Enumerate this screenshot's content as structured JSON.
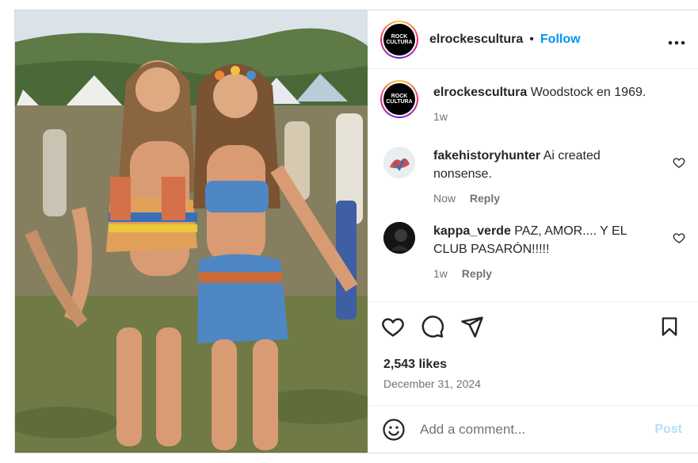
{
  "post": {
    "author": "elrockescultura",
    "separator": "•",
    "follow_label": "Follow",
    "more_icon": "more-horizontal-icon",
    "avatar_text_top": "ROCK",
    "avatar_text_bottom": "CULTURA",
    "photo_description_icon": "post-photo"
  },
  "caption": {
    "user": "elrockescultura",
    "text": "Woodstock en 1969.",
    "time": "1w"
  },
  "comments": [
    {
      "user": "fakehistoryhunter",
      "text": "Ai created nonsense.",
      "time": "Now",
      "reply_label": "Reply",
      "avatar_color": "#cfe3ea"
    },
    {
      "user": "kappa_verde",
      "text": "PAZ, AMOR.... Y EL CLUB PASARÓN!!!!!",
      "time": "1w",
      "reply_label": "Reply",
      "avatar_color": "#1a1a1a"
    }
  ],
  "actions": {
    "like_icon": "heart-icon",
    "comment_icon": "comment-icon",
    "share_icon": "send-icon",
    "save_icon": "bookmark-icon"
  },
  "stats": {
    "likes": "2,543 likes",
    "date": "December 31, 2024"
  },
  "composer": {
    "placeholder": "Add a comment...",
    "post_label": "Post",
    "emoji_icon": "emoji-icon"
  },
  "colors": {
    "accent": "#0095f6",
    "muted": "#737373",
    "post_disabled": "#b2dffc"
  }
}
